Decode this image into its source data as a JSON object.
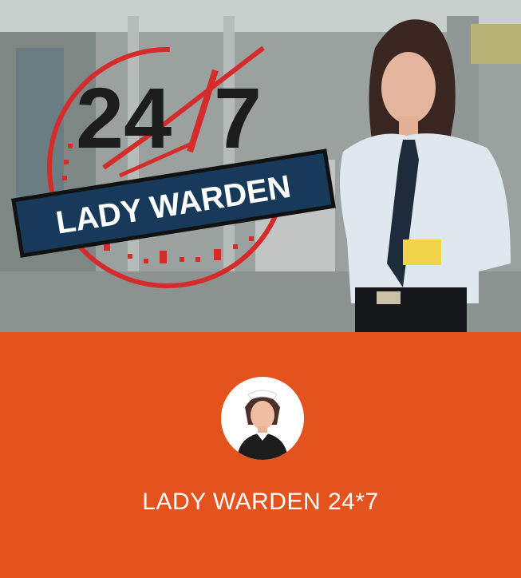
{
  "banner": {
    "logo_number_left": "24",
    "logo_number_right": "7",
    "logo_ribbon_text": "LADY WARDEN"
  },
  "app": {
    "name": "LADY WARDEN 24*7"
  },
  "colors": {
    "accent": "#e4531e",
    "logo_red": "#d42b2b",
    "ribbon_navy": "#173a5a",
    "text_white": "#ffffff"
  },
  "icons": {
    "avatar": "female-warden-avatar-icon"
  }
}
